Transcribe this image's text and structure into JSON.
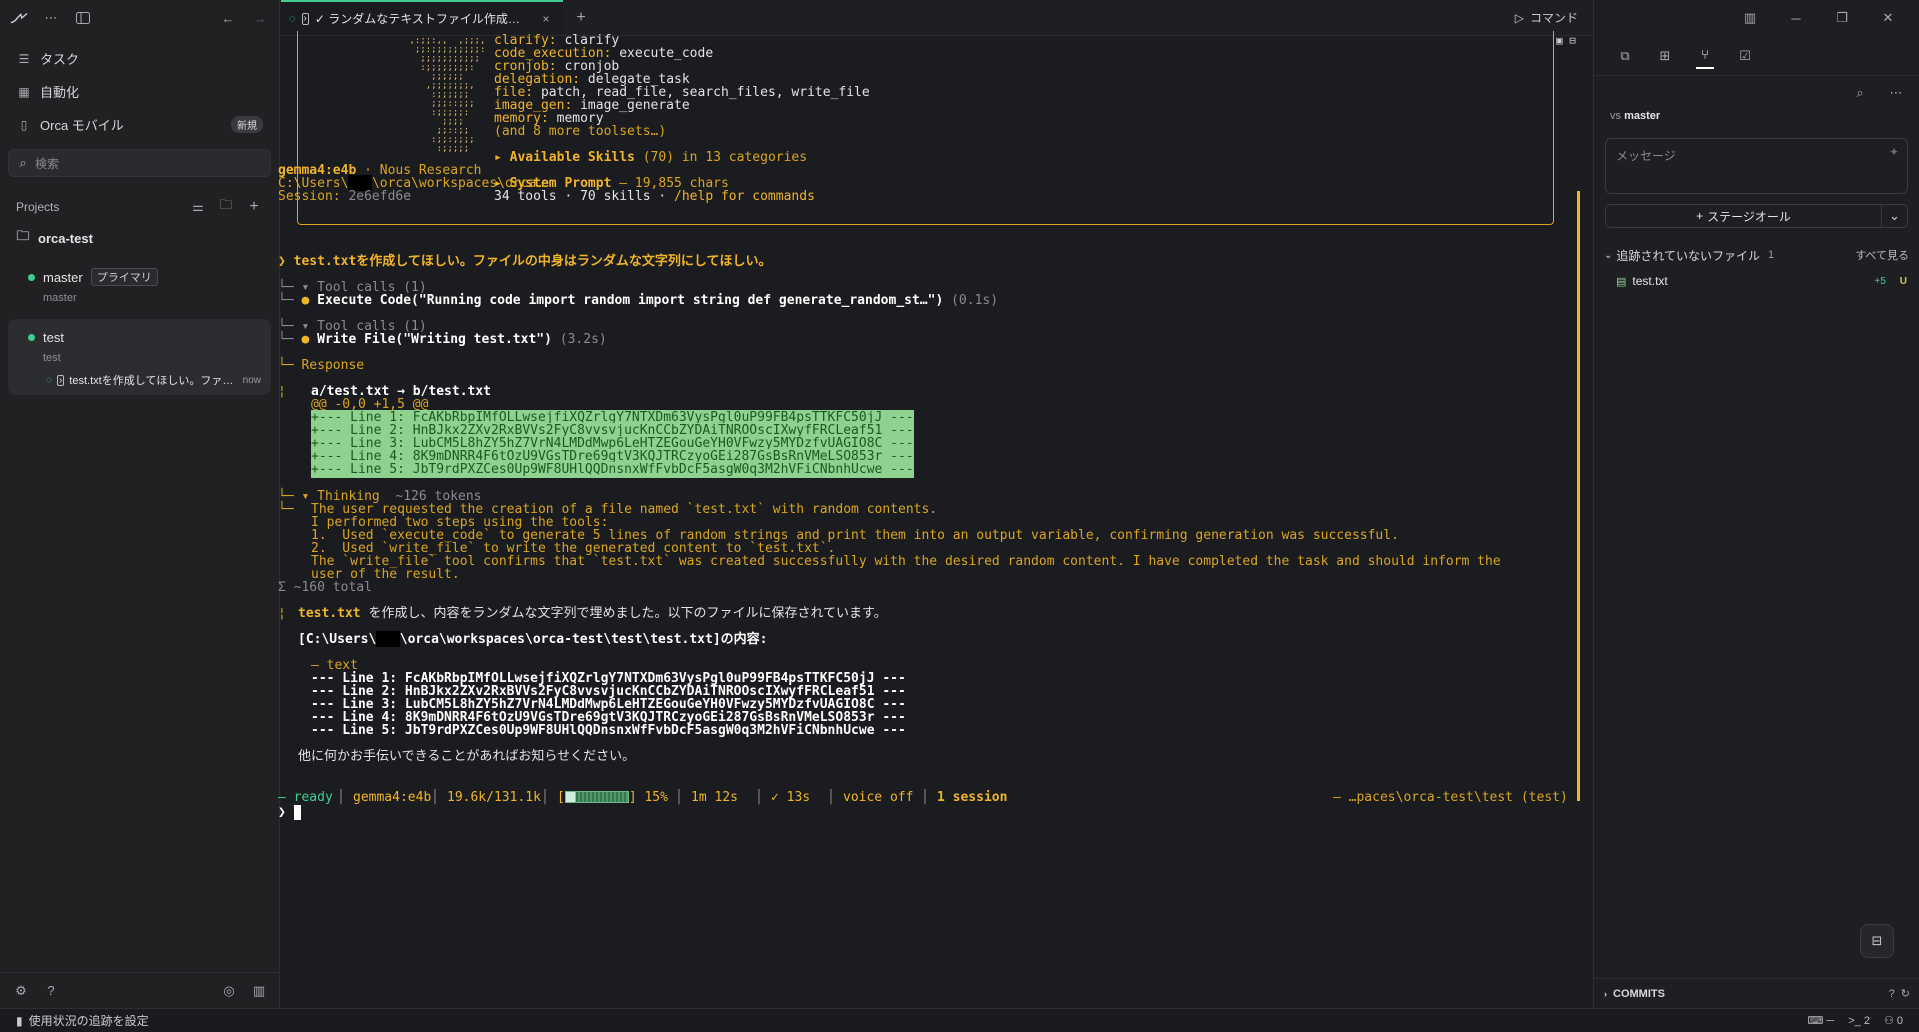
{
  "sidebar": {
    "nav": [
      {
        "label": "タスク",
        "icon": "list-icon"
      },
      {
        "label": "自動化",
        "icon": "calendar-icon"
      },
      {
        "label": "Orca モバイル",
        "icon": "phone-icon",
        "badge": "新規"
      }
    ],
    "search_placeholder": "検索",
    "projects_label": "Projects",
    "project_name": "orca-test",
    "worktrees": [
      {
        "name": "master",
        "badge": "プライマリ",
        "branch": "master"
      },
      {
        "name": "test",
        "branch": "test",
        "task": "test.txtを作成してほしい。ファ…",
        "task_time": "now"
      }
    ]
  },
  "tab": {
    "title": "✓ ランダムなテキストファイル作成の…"
  },
  "command_label": "コマンド",
  "terminal": {
    "banner_lines": [
      [
        "clarify: ",
        "clarify"
      ],
      [
        "code_execution: ",
        "execute_code"
      ],
      [
        "cronjob: ",
        "cronjob"
      ],
      [
        "delegation: ",
        "delegate_task"
      ],
      [
        "file: ",
        "patch, read_file, search_files, write_file"
      ],
      [
        "image_gen: ",
        "image_generate"
      ],
      [
        "memory: ",
        "memory"
      ]
    ],
    "more_toolsets": "(and 8 more toolsets…)",
    "skills_head": "▸ Available Skills",
    "skills_meta": "(70) in 13 categories",
    "prompt_head": "▸ System Prompt",
    "prompt_meta": "— 19,855 chars",
    "tools_summary": "34 tools · 70 skills · ",
    "help_hint": "/help for commands",
    "model": "gemma4:e4b",
    "provider": " · Nous Research",
    "path_prefix": "C:\\Users\\",
    "path_suffix": "\\orca\\workspaces\\orca…",
    "session_label": "Session: ",
    "session_id": "2e6efd6e",
    "user_prompt": "❯ test.txtを作成してほしい。ファイルの中身はランダムな文字列にしてほしい。",
    "toolcalls1_head": "└─ ▾ Tool calls (1)",
    "toolcalls1_item": "Execute Code(\"Running code import random import string def generate_random_st…\")",
    "toolcalls1_time": " (0.1s)",
    "toolcalls2_head": "└─ ▾ Tool calls (1)",
    "toolcalls2_item": "Write File(\"Writing test.txt\")",
    "toolcalls2_time": " (3.2s)",
    "response_head": "└─ Response",
    "diff_header": "a/test.txt → b/test.txt",
    "diff_hunk": "@@ -0,0 +1,5 @@",
    "diff_lines": [
      "+--- Line 1: FcAKbRbpIMfOLLwsejfiXQZrlgY7NTXDm63VysPgl0uP99FB4psTTKFC50jJ ---",
      "+--- Line 2: HnBJkx2ZXv2RxBVVs2FyC8vvsvjucKnCCbZYDAiTNROOscIXwyfFRCLeaf51 ---",
      "+--- Line 3: LubCM5L8hZY5hZ7VrN4LMDdMwp6LeHTZEGouGeYH0VFwzy5MYDzfvUAGIO8C ---",
      "+--- Line 4: 8K9mDNRR4F6tOzU9VGsTDre69gtV3KQJTRCzyoGEi287GsBsRnVMeLSO853r ---",
      "+--- Line 5: JbT9rdPXZCes0Up9WF8UHlQQDnsnxWfFvbDcF5asgW0q3M2hVFiCNbnhUcwe ---"
    ],
    "thinking_head": "└─ ▾ Thinking",
    "thinking_tokens": "~126 tokens",
    "thinking_lines": [
      "The user requested the creation of a file named `test.txt` with random contents.",
      "I performed two steps using the tools:",
      "1.  Used `execute_code` to generate 5 lines of random strings and print them into an output variable, confirming generation was successful.",
      "2.  Used `write_file` to write the generated content to `test.txt`.",
      "The `write_file` tool confirms that `test.txt` was created successfully with the desired random content. I have completed the task and should inform the",
      "user of the result."
    ],
    "total_tokens": "Σ ~160 total",
    "reply_file": "test.txt",
    "reply_text": " を作成し、内容をランダムな文字列で埋めました。以下のファイルに保存されています。",
    "reply_path_prefix": "[C:\\Users\\",
    "reply_path_suffix": "\\orca\\workspaces\\orca-test\\test\\test.txt]の内容:",
    "code_lang": "— text",
    "code_lines": [
      "--- Line 1: FcAKbRbpIMfOLLwsejfiXQZrlgY7NTXDm63VysPgl0uP99FB4psTTKFC50jJ ---",
      "--- Line 2: HnBJkx2ZXv2RxBVVs2FyC8vvsvjucKnCCbZYDAiTNROOscIXwyfFRCLeaf51 ---",
      "--- Line 3: LubCM5L8hZY5hZ7VrN4LMDdMwp6LeHTZEGouGeYH0VFwzy5MYDzfvUAGIO8C ---",
      "--- Line 4: 8K9mDNRR4F6tOzU9VGsTDre69gtV3KQJTRCzyoGEi287GsBsRnVMeLSO853r ---",
      "--- Line 5: JbT9rdPXZCes0Up9WF8UHlQQDnsnxWfFvbDcF5asgW0q3M2hVFiCNbnhUcwe ---"
    ],
    "closing": "他に何かお手伝いできることがあればお知らせください。",
    "status": {
      "ready": "— ready",
      "model": "gemma4:e4b",
      "context": "19.6k/131.1k",
      "context_progress_percent": 15,
      "percent": "15%",
      "elapsed": "1m 12s",
      "last": "✓ 13s",
      "voice": "voice off",
      "sessions": "1 session",
      "cwd": "— …paces\\orca-test\\test (test)"
    },
    "prompt_char": "❯"
  },
  "right_panel": {
    "vs_label": "vs",
    "branch": "master",
    "message_placeholder": "メッセージ",
    "stage_all": "ステージオール",
    "untracked_label": "追跡されていないファイル",
    "untracked_count": "1",
    "see_all": "すべて見る",
    "file_name": "test.txt",
    "file_added": "+5",
    "file_status": "U",
    "commits_label": "COMMITS"
  },
  "app_status": {
    "usage_label": "使用状況の追跡を設定",
    "terminal_count": "2",
    "port_count": "0"
  },
  "colors": {
    "accent_green": "#3ecf8e",
    "accent_orange": "#f0b429",
    "diff_add_bg": "#8fd18f"
  }
}
